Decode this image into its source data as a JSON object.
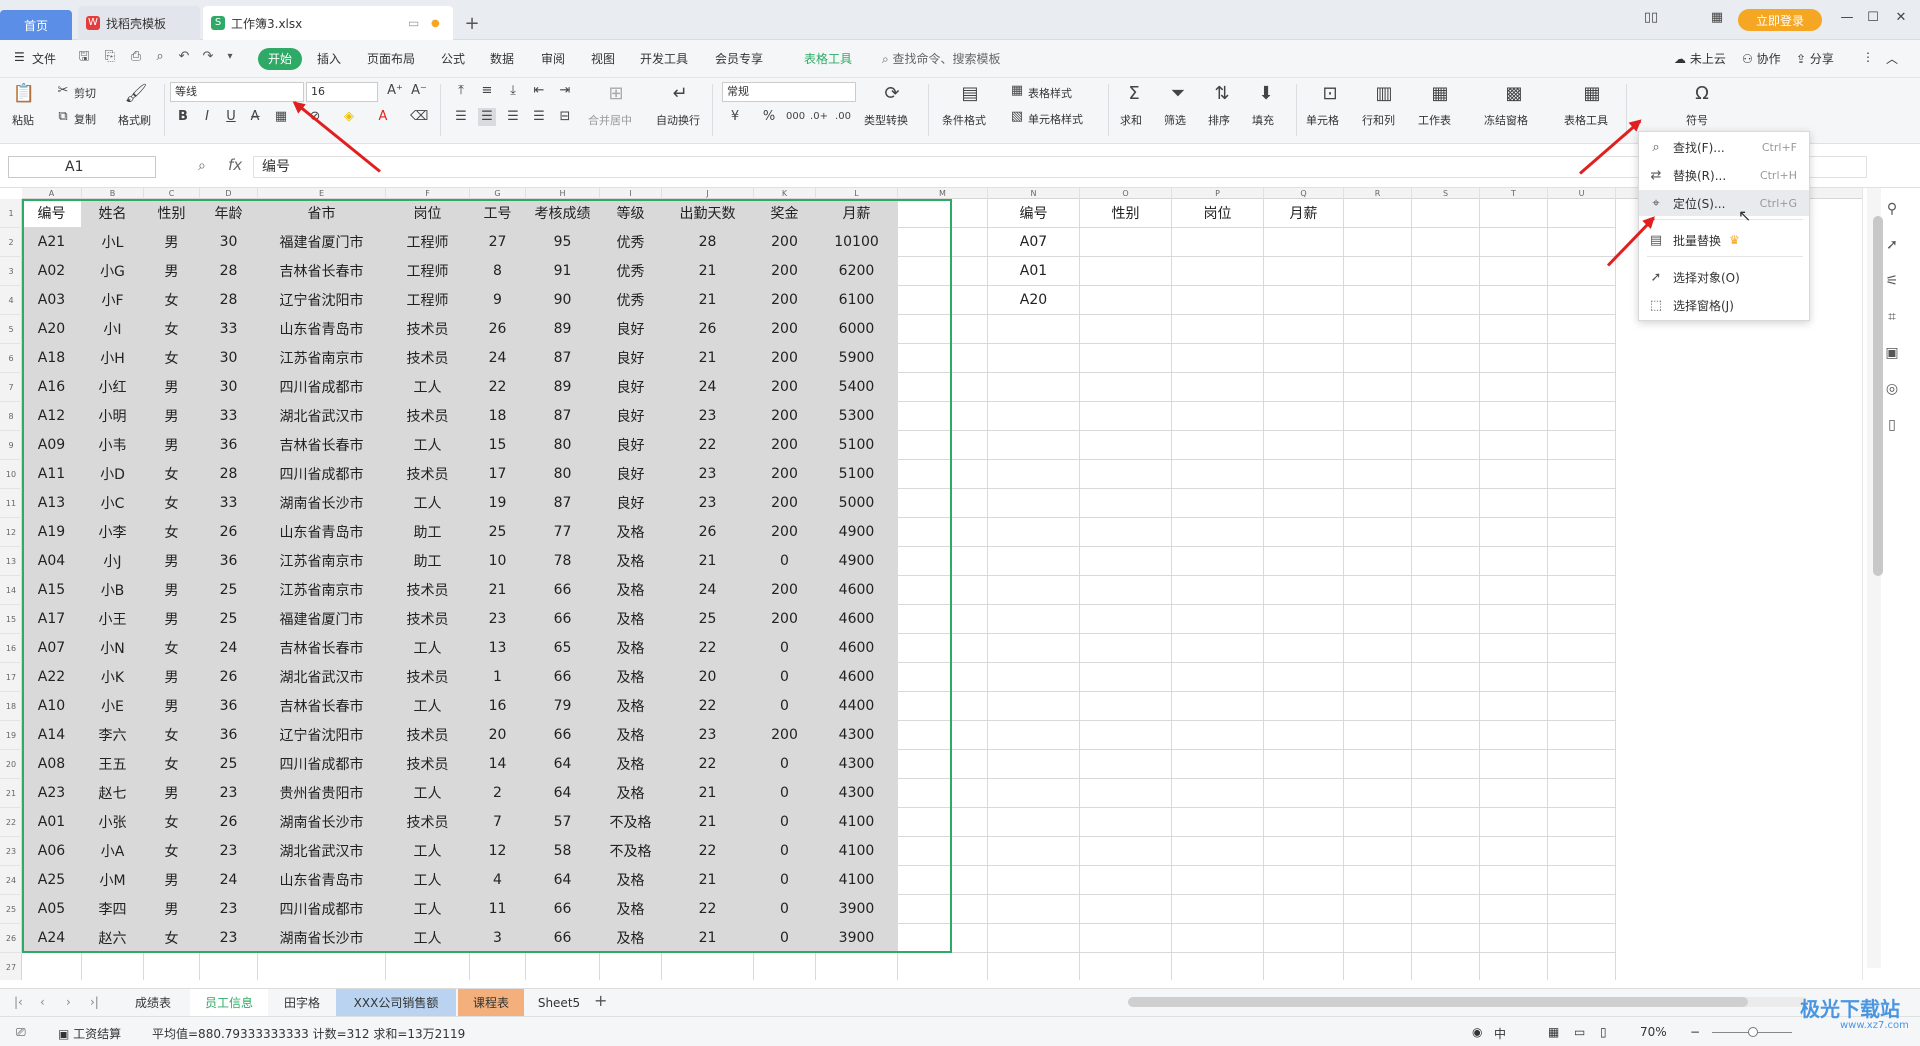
{
  "tabs": {
    "home": "首页",
    "template": "找稻壳模板",
    "workbook": "工作簿3.xlsx",
    "add": "+"
  },
  "top_right": {
    "login": "立即登录"
  },
  "menubar": {
    "file": "文件",
    "items": [
      "开始",
      "插入",
      "页面布局",
      "公式",
      "数据",
      "审阅",
      "视图",
      "开发工具",
      "会员专享",
      "表格工具"
    ],
    "search": "查找命令、搜索模板",
    "cloud": "未上云",
    "collab": "协作",
    "share": "分享"
  },
  "ribbon": {
    "paste": "粘贴",
    "cut": "剪切",
    "copy": "复制",
    "format_painter": "格式刷",
    "font_name": "等线",
    "font_size": "16",
    "merge": "合并居中",
    "wrap": "自动换行",
    "number_format": "常规",
    "convert": "类型转换",
    "cond_format": "条件格式",
    "table_style": "表格样式",
    "cell_style": "单元格样式",
    "sum": "求和",
    "filter": "筛选",
    "sort": "排序",
    "fill": "填充",
    "cell": "单元格",
    "rowcol": "行和列",
    "sheet": "工作表",
    "freeze": "冻结窗格",
    "table_tools": "表格工具",
    "find": "查找",
    "symbol": "符号"
  },
  "formula_bar": {
    "name_box": "A1",
    "fx": "fx",
    "content": "编号"
  },
  "columns": [
    "A",
    "B",
    "C",
    "D",
    "E",
    "F",
    "G",
    "H",
    "I",
    "J",
    "K",
    "L",
    "M",
    "N",
    "O",
    "P",
    "Q",
    "R",
    "S",
    "T",
    "U"
  ],
  "table": {
    "headers": [
      "编号",
      "姓名",
      "性别",
      "年龄",
      "省市",
      "岗位",
      "工号",
      "考核成绩",
      "等级",
      "出勤天数",
      "奖金",
      "月薪"
    ],
    "rows": [
      [
        "A21",
        "小L",
        "男",
        "30",
        "福建省厦门市",
        "工程师",
        "27",
        "95",
        "优秀",
        "28",
        "200",
        "10100"
      ],
      [
        "A02",
        "小G",
        "男",
        "28",
        "吉林省长春市",
        "工程师",
        "8",
        "91",
        "优秀",
        "21",
        "200",
        "6200"
      ],
      [
        "A03",
        "小F",
        "女",
        "28",
        "辽宁省沈阳市",
        "工程师",
        "9",
        "90",
        "优秀",
        "21",
        "200",
        "6100"
      ],
      [
        "A20",
        "小I",
        "女",
        "33",
        "山东省青岛市",
        "技术员",
        "26",
        "89",
        "良好",
        "26",
        "200",
        "6000"
      ],
      [
        "A18",
        "小H",
        "女",
        "30",
        "江苏省南京市",
        "技术员",
        "24",
        "87",
        "良好",
        "21",
        "200",
        "5900"
      ],
      [
        "A16",
        "小红",
        "男",
        "30",
        "四川省成都市",
        "工人",
        "22",
        "89",
        "良好",
        "24",
        "200",
        "5400"
      ],
      [
        "A12",
        "小明",
        "男",
        "33",
        "湖北省武汉市",
        "技术员",
        "18",
        "87",
        "良好",
        "23",
        "200",
        "5300"
      ],
      [
        "A09",
        "小韦",
        "男",
        "36",
        "吉林省长春市",
        "工人",
        "15",
        "80",
        "良好",
        "22",
        "200",
        "5100"
      ],
      [
        "A11",
        "小D",
        "女",
        "28",
        "四川省成都市",
        "技术员",
        "17",
        "80",
        "良好",
        "23",
        "200",
        "5100"
      ],
      [
        "A13",
        "小C",
        "女",
        "33",
        "湖南省长沙市",
        "工人",
        "19",
        "87",
        "良好",
        "23",
        "200",
        "5000"
      ],
      [
        "A19",
        "小李",
        "女",
        "26",
        "山东省青岛市",
        "助工",
        "25",
        "77",
        "及格",
        "26",
        "200",
        "4900"
      ],
      [
        "A04",
        "小J",
        "男",
        "36",
        "江苏省南京市",
        "助工",
        "10",
        "78",
        "及格",
        "21",
        "0",
        "4900"
      ],
      [
        "A15",
        "小B",
        "男",
        "25",
        "江苏省南京市",
        "技术员",
        "21",
        "66",
        "及格",
        "24",
        "200",
        "4600"
      ],
      [
        "A17",
        "小王",
        "男",
        "25",
        "福建省厦门市",
        "技术员",
        "23",
        "66",
        "及格",
        "25",
        "200",
        "4600"
      ],
      [
        "A07",
        "小N",
        "女",
        "24",
        "吉林省长春市",
        "工人",
        "13",
        "65",
        "及格",
        "22",
        "0",
        "4600"
      ],
      [
        "A22",
        "小K",
        "男",
        "26",
        "湖北省武汉市",
        "技术员",
        "1",
        "66",
        "及格",
        "20",
        "0",
        "4600"
      ],
      [
        "A10",
        "小E",
        "男",
        "36",
        "吉林省长春市",
        "工人",
        "16",
        "79",
        "及格",
        "22",
        "0",
        "4400"
      ],
      [
        "A14",
        "李六",
        "女",
        "36",
        "辽宁省沈阳市",
        "技术员",
        "20",
        "66",
        "及格",
        "23",
        "200",
        "4300"
      ],
      [
        "A08",
        "王五",
        "女",
        "25",
        "四川省成都市",
        "技术员",
        "14",
        "64",
        "及格",
        "22",
        "0",
        "4300"
      ],
      [
        "A23",
        "赵七",
        "男",
        "23",
        "贵州省贵阳市",
        "工人",
        "2",
        "64",
        "及格",
        "21",
        "0",
        "4300"
      ],
      [
        "A01",
        "小张",
        "女",
        "26",
        "湖南省长沙市",
        "技术员",
        "7",
        "57",
        "不及格",
        "21",
        "0",
        "4100"
      ],
      [
        "A06",
        "小A",
        "女",
        "23",
        "湖北省武汉市",
        "工人",
        "12",
        "58",
        "不及格",
        "22",
        "0",
        "4100"
      ],
      [
        "A25",
        "小M",
        "男",
        "24",
        "山东省青岛市",
        "工人",
        "4",
        "64",
        "及格",
        "21",
        "0",
        "4100"
      ],
      [
        "A05",
        "李四",
        "男",
        "23",
        "四川省成都市",
        "工人",
        "11",
        "66",
        "及格",
        "22",
        "0",
        "3900"
      ],
      [
        "A24",
        "赵六",
        "女",
        "23",
        "湖南省长沙市",
        "工人",
        "3",
        "66",
        "及格",
        "21",
        "0",
        "3900"
      ]
    ]
  },
  "side_table": {
    "headers": [
      "编号",
      "性别",
      "岗位",
      "月薪"
    ],
    "ids": [
      "A07",
      "A01",
      "A20"
    ]
  },
  "dropdown": {
    "items": [
      {
        "label": "查找(F)...",
        "shortcut": "Ctrl+F",
        "icon": "search-icon"
      },
      {
        "label": "替换(R)...",
        "shortcut": "Ctrl+H",
        "icon": "replace-icon"
      },
      {
        "label": "定位(S)...",
        "shortcut": "Ctrl+G",
        "icon": "locate-icon"
      },
      {
        "label": "批量替换",
        "shortcut": "",
        "icon": "batch-replace-icon"
      },
      {
        "label": "选择对象(O)",
        "shortcut": "",
        "icon": "select-object-icon"
      },
      {
        "label": "选择窗格(J)",
        "shortcut": "",
        "icon": "selection-pane-icon"
      }
    ]
  },
  "sheets": [
    "成绩表",
    "员工信息",
    "田字格",
    "XXX公司销售额",
    "课程表",
    "Sheet5"
  ],
  "active_sheet": "员工信息",
  "status": {
    "salary": "工资结算",
    "summary": "平均值=880.79333333333  计数=312  求和=13万2119",
    "lang": "中",
    "zoom": "70%"
  },
  "watermark": {
    "brand": "极光下载站",
    "url": "www.xz7.com"
  },
  "colors": {
    "accent": "#2eaa66",
    "tab_blue": "#5b8ee6",
    "login": "#f5a623",
    "arrow": "#e02020"
  }
}
